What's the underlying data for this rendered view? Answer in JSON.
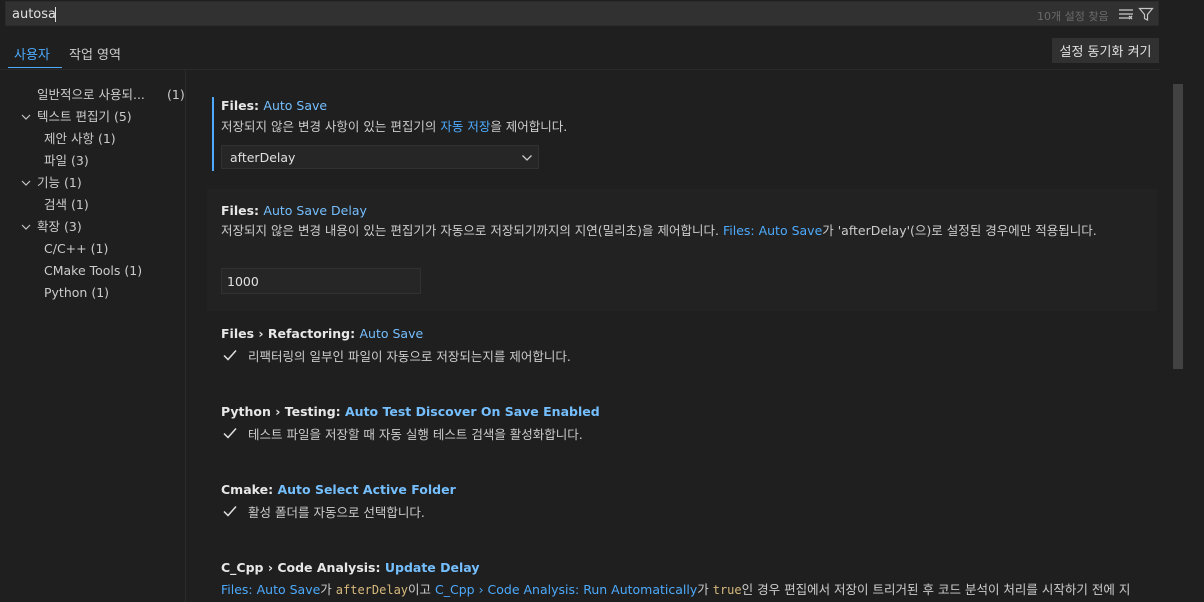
{
  "search": {
    "value": "autosa",
    "result_count": "10개 설정 찾음",
    "filter_list_icon": "list-filter-icon",
    "filter_icon": "funnel-icon"
  },
  "tabs": [
    {
      "label": "사용자",
      "active": true
    },
    {
      "label": "작업 영역",
      "active": false
    }
  ],
  "sync_button": "설정 동기화 켜기",
  "toc": [
    {
      "label": "일반적으로 사용되...",
      "count": "(1)"
    },
    {
      "label": "텍스트 편집기",
      "count": "(5)"
    },
    {
      "label": "제안 사항",
      "count": "(1)"
    },
    {
      "label": "파일",
      "count": "(3)"
    },
    {
      "label": "기능",
      "count": "(1)"
    },
    {
      "label": "검색",
      "count": "(1)"
    },
    {
      "label": "확장",
      "count": "(3)"
    },
    {
      "label": "C/C++",
      "count": "(1)"
    },
    {
      "label": "CMake Tools",
      "count": "(1)"
    },
    {
      "label": "Python",
      "count": "(1)"
    }
  ],
  "settings": {
    "auto_save": {
      "category": "Files: ",
      "key": "Auto Save",
      "desc_pre": "저장되지 않은 변경 사항이 있는 편집기의 ",
      "desc_link": "자동 저장",
      "desc_post": "을 제어합니다.",
      "value": "afterDelay"
    },
    "auto_save_delay": {
      "category": "Files: ",
      "key": "Auto Save Delay",
      "desc_pre": "저장되지 않은 변경 내용이 있는 편집기가 자동으로 저장되기까지의 지연(밀리초)을 제어합니다. ",
      "desc_link": "Files: Auto Save",
      "desc_post": "가 'afterDelay'(으)로 설정된 경우에만 적용됩니다.",
      "value": "1000"
    },
    "refactoring": {
      "category": "Files › Refactoring: ",
      "key": "Auto Save",
      "desc": "리팩터링의 일부인 파일이 자동으로 저장되는지를 제어합니다.",
      "checked": true
    },
    "python_testing": {
      "category": "Python › Testing: ",
      "key": "Auto Test Discover On Save Enabled",
      "desc": "테스트 파일을 저장할 때 자동 실행 테스트 검색을 활성화합니다.",
      "checked": true
    },
    "cmake": {
      "category": "Cmake: ",
      "key": "Auto Select Active Folder",
      "desc": "활성 폴더를 자동으로 선택합니다.",
      "checked": true
    },
    "cpp": {
      "category": "C_Cpp › Code Analysis: ",
      "key": "Update Delay",
      "link1": "Files: Auto Save",
      "t1": "가 ",
      "code1": "afterDelay",
      "t2": "이고 ",
      "link2": "C_Cpp › Code Analysis: Run Automatically",
      "t3": "가 ",
      "code2": "true",
      "t4": "인 경우 편집에서 저장이 트리거된 후 코드 분석이 처리를 시작하기 전에 지"
    }
  },
  "colors": {
    "accent": "#4daafc",
    "setting_key": "#75bfff",
    "code": "#d7ba7d",
    "background": "#1f1f1f"
  }
}
